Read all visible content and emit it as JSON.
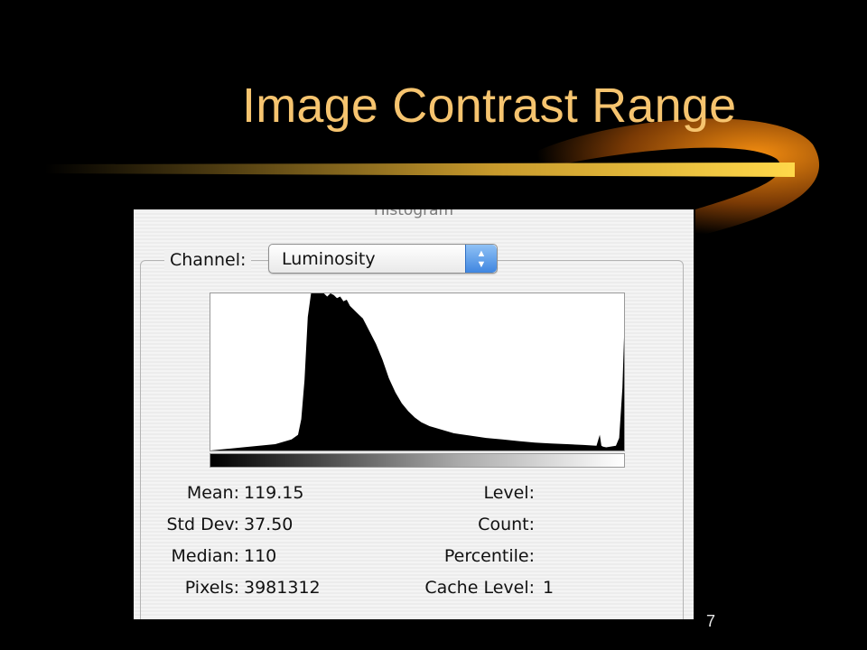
{
  "slide": {
    "title": "Image Contrast Range",
    "number": "7"
  },
  "histogram_panel": {
    "title": "Histogram",
    "channel_label": "Channel:",
    "channel_value": "Luminosity",
    "stats_left": [
      {
        "label": "Mean:",
        "value": "119.15"
      },
      {
        "label": "Std Dev:",
        "value": "37.50"
      },
      {
        "label": "Median:",
        "value": "110"
      },
      {
        "label": "Pixels:",
        "value": "3981312"
      }
    ],
    "stats_right": [
      {
        "label": "Level:",
        "value": ""
      },
      {
        "label": "Count:",
        "value": ""
      },
      {
        "label": "Percentile:",
        "value": ""
      },
      {
        "label": "Cache Level:",
        "value": "1"
      }
    ]
  },
  "chart_data": {
    "type": "area",
    "x": [
      0,
      20,
      40,
      50,
      54,
      56,
      58,
      60,
      62,
      64,
      66,
      68,
      70,
      72,
      74,
      76,
      78,
      80,
      82,
      84,
      86,
      88,
      90,
      92,
      94,
      96,
      98,
      100,
      102,
      104,
      106,
      108,
      110,
      114,
      118,
      122,
      126,
      130,
      135,
      140,
      145,
      150,
      160,
      170,
      180,
      190,
      200,
      210,
      220,
      230,
      238,
      240,
      241,
      242,
      244,
      250,
      252,
      254,
      255
    ],
    "y": [
      0,
      0.02,
      0.04,
      0.07,
      0.1,
      0.2,
      0.45,
      0.85,
      1.0,
      1.0,
      1.0,
      1.0,
      1.0,
      0.98,
      1.0,
      0.99,
      0.97,
      0.98,
      0.95,
      0.96,
      0.92,
      0.9,
      0.88,
      0.86,
      0.84,
      0.8,
      0.76,
      0.72,
      0.68,
      0.63,
      0.58,
      0.52,
      0.46,
      0.37,
      0.3,
      0.25,
      0.21,
      0.18,
      0.155,
      0.14,
      0.125,
      0.11,
      0.095,
      0.08,
      0.07,
      0.06,
      0.05,
      0.045,
      0.04,
      0.035,
      0.03,
      0.1,
      0.03,
      0.025,
      0.02,
      0.03,
      0.08,
      0.4,
      0.72
    ],
    "xlim": [
      0,
      255
    ],
    "ylim": [
      0,
      1
    ],
    "grid": false
  }
}
